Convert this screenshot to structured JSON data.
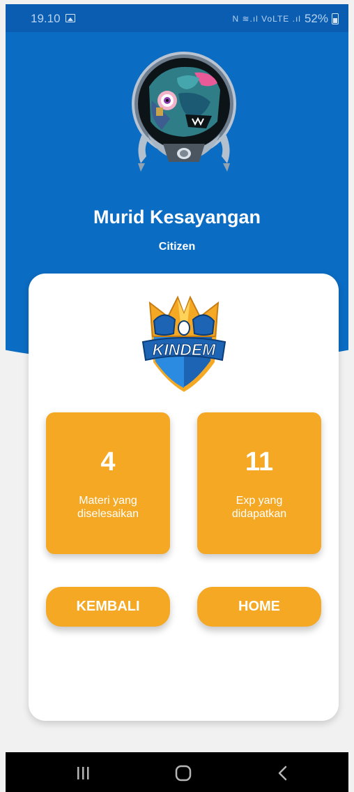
{
  "status_bar": {
    "time": "19.10",
    "signal_icons": "N ≋.ıl VoLTE .ıl",
    "battery": "52%",
    "icons": [
      "gallery-icon",
      "nfc-icon",
      "wifi-icon",
      "signal-icon",
      "battery-icon"
    ]
  },
  "profile": {
    "name": "Murid Kesayangan",
    "rank": "Citizen"
  },
  "logo": {
    "text": "KINDEM"
  },
  "stats": [
    {
      "value": "4",
      "label": "Materi yang diselesaikan"
    },
    {
      "value": "11",
      "label": "Exp yang didapatkan"
    }
  ],
  "buttons": {
    "back_label": "KEMBALI",
    "home_label": "HOME"
  },
  "nav": {
    "items": [
      "recent-apps-icon",
      "home-icon",
      "back-icon"
    ]
  },
  "colors": {
    "header_blue": "#0b6cc3",
    "status_blue": "#0a5db1",
    "accent_orange": "#f4a824",
    "background": "#f1f1f1",
    "card": "#ffffff"
  }
}
